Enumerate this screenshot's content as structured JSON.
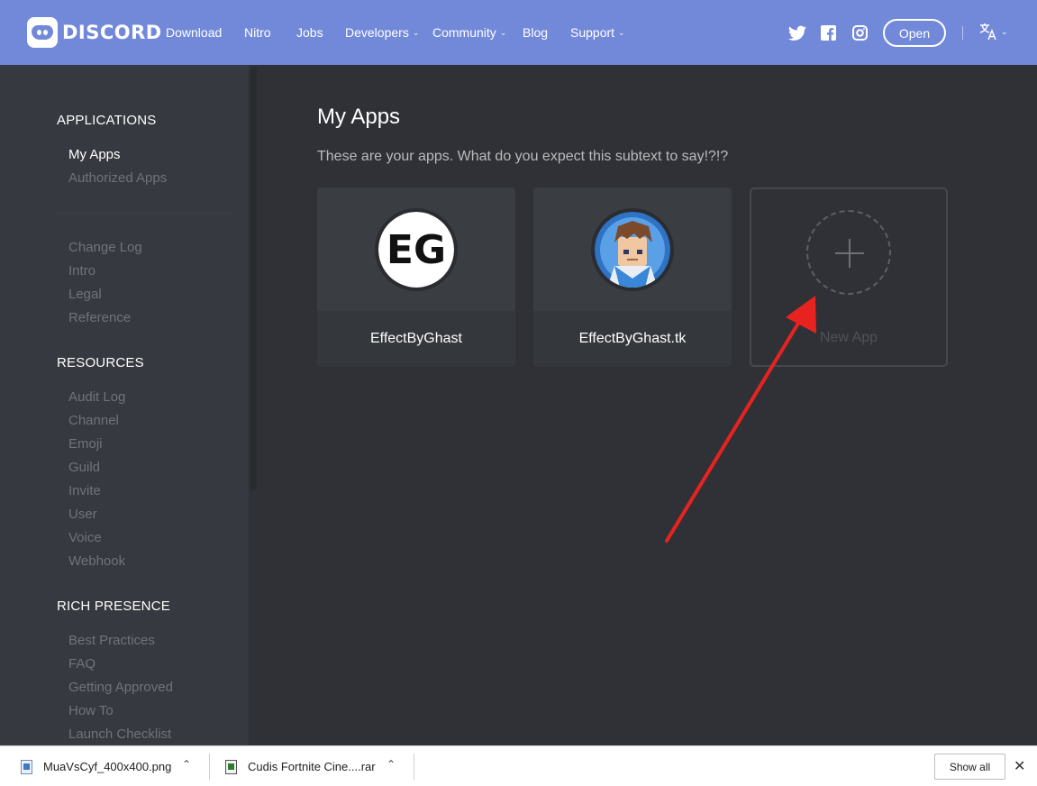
{
  "nav": {
    "brand": "DISCORD",
    "items": [
      {
        "label": "Download",
        "dropdown": false
      },
      {
        "label": "Nitro",
        "dropdown": false
      },
      {
        "label": "Jobs",
        "dropdown": false
      },
      {
        "label": "Developers",
        "dropdown": true
      },
      {
        "label": "Community",
        "dropdown": true
      },
      {
        "label": "Blog",
        "dropdown": false
      },
      {
        "label": "Support",
        "dropdown": true
      }
    ],
    "open_button": "Open",
    "icons": [
      "twitter-icon",
      "facebook-icon",
      "instagram-icon",
      "translate-icon"
    ]
  },
  "sidebar": {
    "applications_title": "APPLICATIONS",
    "applications": [
      {
        "label": "My Apps",
        "active": true
      },
      {
        "label": "Authorized Apps",
        "active": false
      }
    ],
    "docs": [
      "Change Log",
      "Intro",
      "Legal",
      "Reference"
    ],
    "resources_title": "RESOURCES",
    "resources": [
      "Audit Log",
      "Channel",
      "Emoji",
      "Guild",
      "Invite",
      "User",
      "Voice",
      "Webhook"
    ],
    "rich_presence_title": "RICH PRESENCE",
    "rich_presence": [
      "Best Practices",
      "FAQ",
      "Getting Approved",
      "How To",
      "Launch Checklist"
    ]
  },
  "main": {
    "title": "My Apps",
    "subtext": "These are your apps. What do you expect this subtext to say!?!?",
    "apps": [
      {
        "name": "EffectByGhast",
        "avatar_text": "EG"
      },
      {
        "name": "EffectByGhast.tk"
      }
    ],
    "new_app_label": "New App"
  },
  "downloads": {
    "items": [
      {
        "filename": "MuaVsCyf_400x400.png"
      },
      {
        "filename": "Cudis Fortnite Cine....rar"
      }
    ],
    "show_all": "Show all",
    "close": "✕"
  },
  "colors": {
    "blurple": "#7289da",
    "sidebar_bg": "#36393f",
    "main_bg": "#2f3136",
    "arrow": "#e8231f"
  }
}
